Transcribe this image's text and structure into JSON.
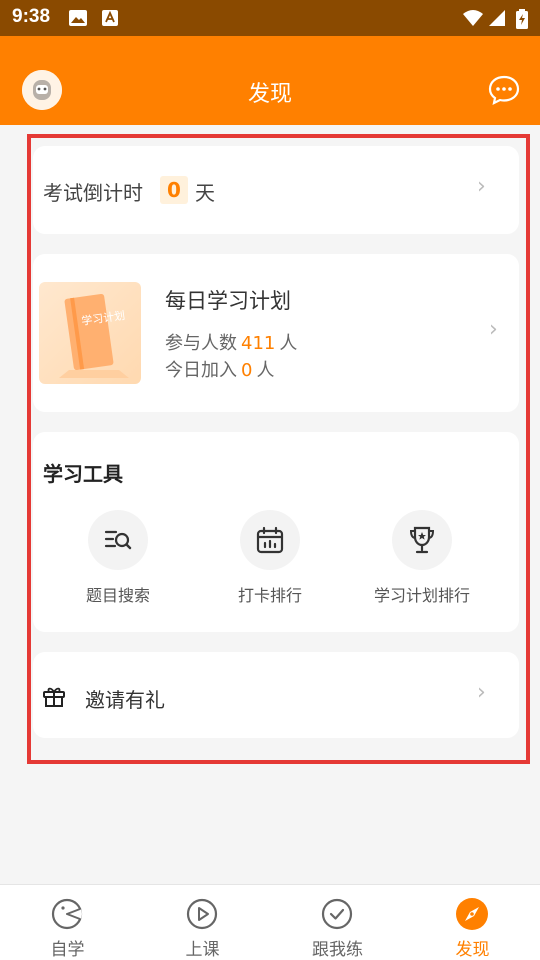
{
  "status_bar": {
    "time": "9:38"
  },
  "app_bar": {
    "title": "发现"
  },
  "countdown": {
    "label": "考试倒计时",
    "days": "0",
    "unit": "天"
  },
  "daily_plan": {
    "image_text": "学习计划",
    "title": "每日学习计划",
    "participants_label": "参与人数",
    "participants": "411",
    "participants_unit": "人",
    "today_label": "今日加入",
    "today": "0",
    "today_unit": "人"
  },
  "tools": {
    "title": "学习工具",
    "items": [
      {
        "label": "题目搜索",
        "icon": "search-list-icon"
      },
      {
        "label": "打卡排行",
        "icon": "calendar-icon"
      },
      {
        "label": "学习计划排行",
        "icon": "trophy-icon"
      }
    ]
  },
  "invite": {
    "label": "邀请有礼",
    "icon": "gift-icon"
  },
  "tab_bar": {
    "items": [
      {
        "label": "自学",
        "icon": "self-study-icon"
      },
      {
        "label": "上课",
        "icon": "play-icon"
      },
      {
        "label": "跟我练",
        "icon": "check-icon"
      },
      {
        "label": "发现",
        "icon": "compass-icon"
      }
    ],
    "active": "发现"
  },
  "colors": {
    "accent": "#ff8000",
    "status_bar": "#8a4a00",
    "highlight_border": "#e53935"
  }
}
